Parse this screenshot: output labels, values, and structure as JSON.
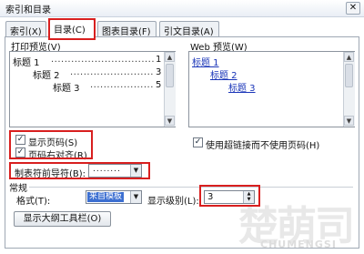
{
  "window": {
    "title": "索引和目录",
    "close_glyph": "✕"
  },
  "tabs": [
    {
      "label": "索引(X)",
      "active": false
    },
    {
      "label": "目录(C)",
      "active": true
    },
    {
      "label": "图表目录(F)",
      "active": false
    },
    {
      "label": "引文目录(A)",
      "active": false
    }
  ],
  "print_preview": {
    "label": "打印预览(V)",
    "lines": [
      {
        "text": "标题 1",
        "page": "1"
      },
      {
        "text": "标题 2",
        "page": "3"
      },
      {
        "text": "标题 3",
        "page": "5"
      }
    ],
    "dots": "................................................"
  },
  "web_preview": {
    "label": "Web 预览(W)",
    "links": [
      "标题 1",
      "标题 2",
      "标题 3"
    ]
  },
  "options": {
    "show_page_numbers": {
      "label": "显示页码(S)",
      "checked": true
    },
    "right_align": {
      "label": "页码右对齐(R)",
      "checked": true
    },
    "use_hyperlinks": {
      "label": "使用超链接而不使用页码(H)",
      "checked": true
    },
    "tab_leader": {
      "label": "制表符前导符(B):",
      "value": "........"
    }
  },
  "general": {
    "label": "常规",
    "formats": {
      "label": "格式(T):",
      "value": "来自模板"
    },
    "levels": {
      "label": "显示级别(L):",
      "value": "3"
    }
  },
  "buttons": {
    "outline_toolbar": "显示大纲工具栏(O)"
  },
  "icons": {
    "check": "✓",
    "dropdown": "▼",
    "up": "▲",
    "down": "▼"
  },
  "watermark": {
    "big": "楚萌司",
    "small": "CHUMENGSI"
  }
}
